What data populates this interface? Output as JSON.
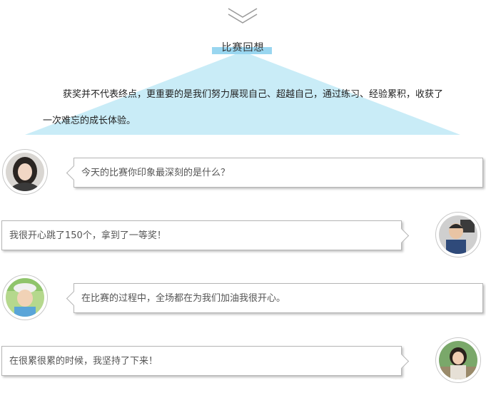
{
  "section": {
    "title": "比赛回想",
    "intro": "获奖并不代表终点，更重要的是我们努力展现自己、超越自己，通过练习、经验累积，收获了一次难忘的成长体验。"
  },
  "icons": {
    "header": "double-chevron-down-icon"
  },
  "colors": {
    "accent_blue": "#99d6f0",
    "triangle_fill": "#c9ecf7"
  },
  "dialogue": [
    {
      "speaker": "interviewer",
      "text": "今天的比赛你印象最深刻的是什么？"
    },
    {
      "speaker": "child",
      "text": "我很开心跳了150个，拿到了一等奖！"
    },
    {
      "speaker": "interviewer",
      "text": "在比赛的过程中，全场都在为我们加油我很开心。"
    },
    {
      "speaker": "child",
      "text": "在很累很累的时候，我坚持了下来！"
    }
  ]
}
